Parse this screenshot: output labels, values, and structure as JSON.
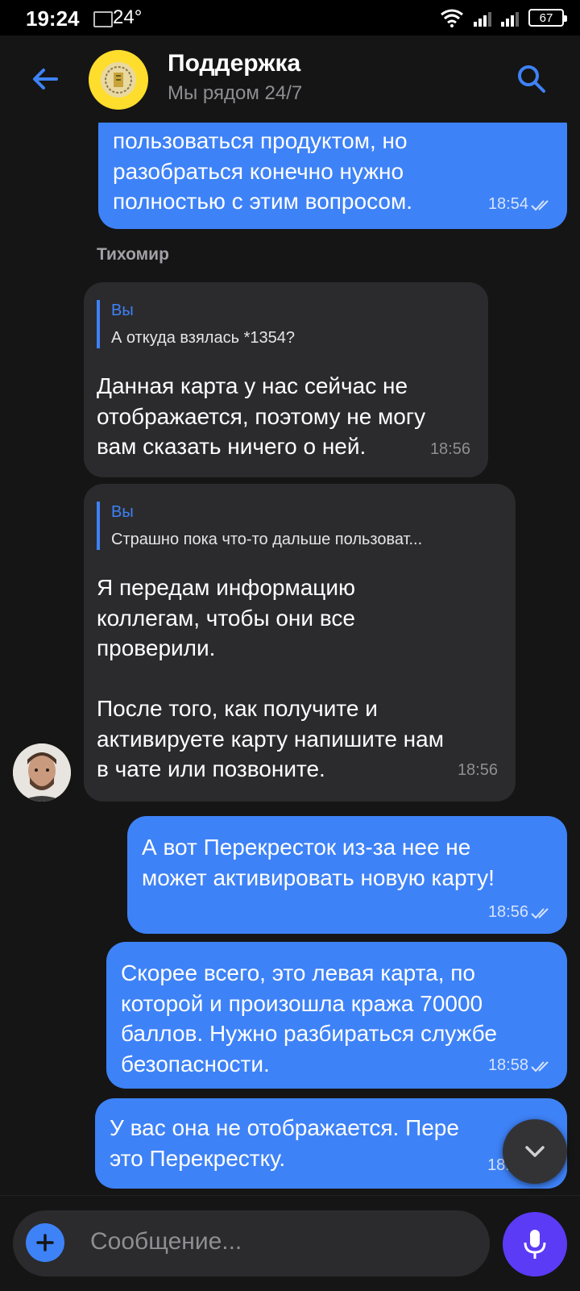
{
  "status_bar": {
    "time": "19:24",
    "temperature": "24°",
    "battery": "67"
  },
  "header": {
    "title": "Поддержка",
    "subtitle": "Мы рядом 24/7"
  },
  "messages": [
    {
      "text": "пользоваться продуктом, но\nразобраться конечно нужно\nполностью с этим вопросом.",
      "time": "18:54"
    },
    {
      "sender": "Тихомир"
    },
    {
      "quote_name": "Вы",
      "quote_text": "А откуда взялась *1354?",
      "text": "Данная карта у нас сейчас не\nотображается, поэтому не могу\nвам сказать ничего о ней.",
      "time": "18:56"
    },
    {
      "quote_name": "Вы",
      "quote_text": "Страшно пока что-то дальше пользоват...",
      "text": "Я передам информацию\nколлегам, чтобы они все\nпроверили.\n\nПосле того, как получите и\nактивируете карту напишите нам\nв чате или позвоните.",
      "time": "18:56"
    },
    {
      "text": "А вот Перекресток из-за нее не\nможет активировать новую карту!",
      "time": "18:56"
    },
    {
      "text": "Скорее всего, это левая карта, по\nкоторой и произошла кража 70000\nбаллов. Нужно разбираться службе\nбезопасности.",
      "time": "18:58"
    },
    {
      "text": "У вас она не отображается. Пере\nэто Перекрестку.",
      "time": "18:5"
    }
  ],
  "input": {
    "placeholder": "Сообщение..."
  },
  "colors": {
    "outgoing_bubble": "#3e82f7",
    "incoming_bubble": "#2b2b2e",
    "background": "#151515",
    "mic_button": "#5b3bf5",
    "logo": "#ffdd2d"
  }
}
